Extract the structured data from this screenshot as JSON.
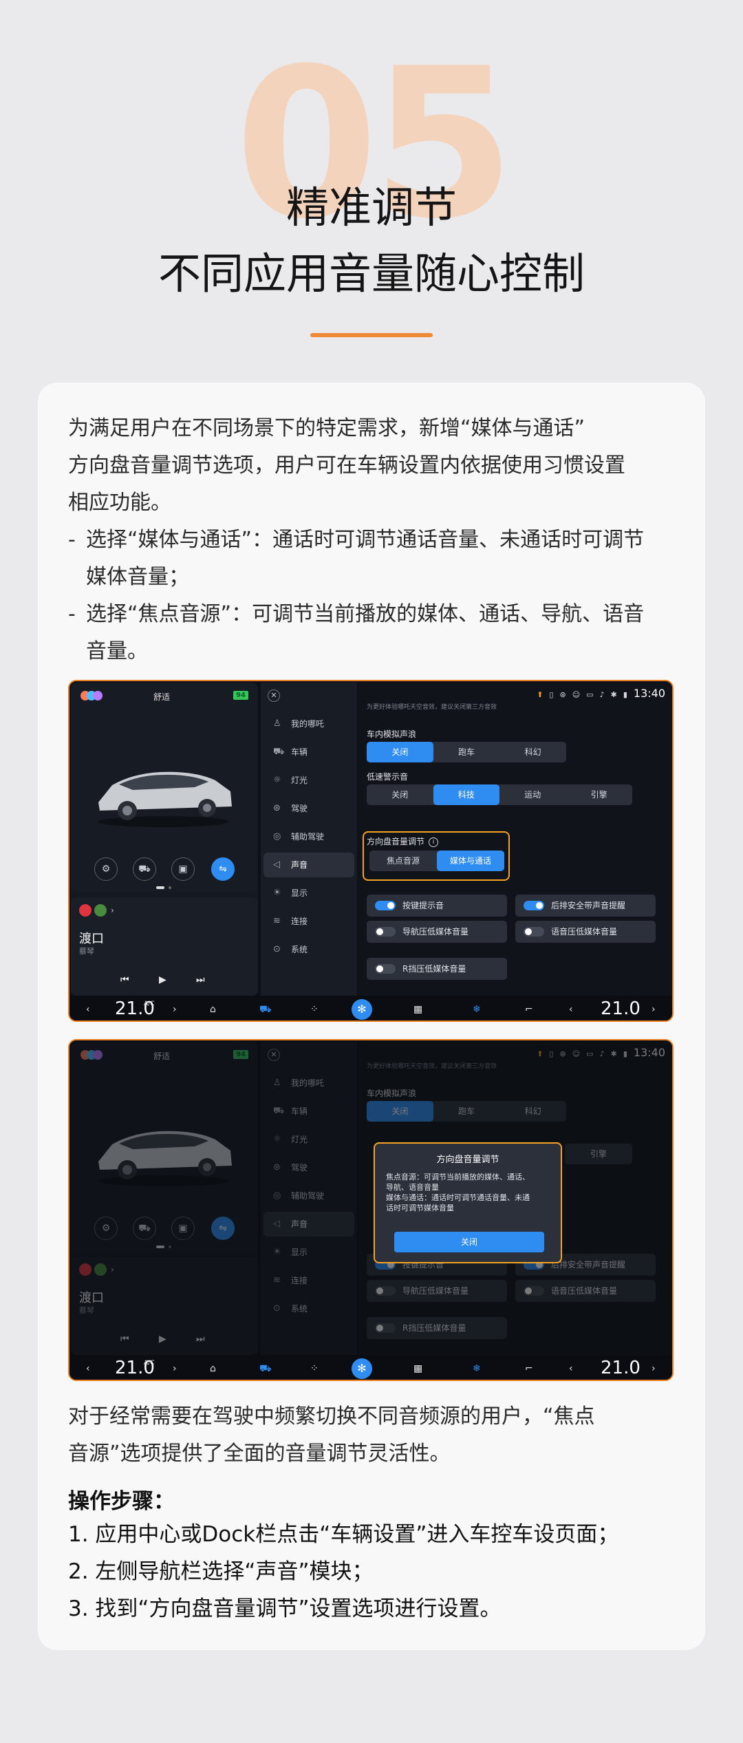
{
  "header": {
    "number": "05",
    "title_line1": "精准调节",
    "title_line2": "不同应用音量随心控制",
    "accent_color": "#f08a34"
  },
  "intro": {
    "line1": "为满足用户在不同场景下的特定需求，新增“媒体与通话”",
    "line2": "方向盘音量调节选项，用户可在车辆设置内依据使用习惯设置",
    "line3": "相应功能。",
    "bullet1_a": "选择“媒体与通话”：通话时可调节通话音量、未通话时可调节",
    "bullet1_b": "媒体音量；",
    "bullet2_a": "选择“焦点音源”：可调节当前播放的媒体、通话、导航、语音",
    "bullet2_b": "音量。"
  },
  "screen": {
    "mode": "舒适",
    "battery": "94",
    "track": "渡口",
    "artist": "蔡琴",
    "time": "13:40",
    "hint": "为更好体验哪吒天空音效，建议关闭第三方音效",
    "nav": [
      "我的哪吒",
      "车辆",
      "灯光",
      "驾驶",
      "辅助驾驶",
      "声音",
      "显示",
      "连接",
      "系统"
    ],
    "sim_wave_label": "车内模拟声浪",
    "sim_wave_options": [
      "关闭",
      "跑车",
      "科幻"
    ],
    "sim_wave_selected": "关闭",
    "low_speed_label": "低速警示音",
    "low_speed_options": [
      "关闭",
      "科技",
      "运动",
      "引擎"
    ],
    "low_speed_selected": "科技",
    "wheel_label": "方向盘音量调节",
    "wheel_options": [
      "焦点音源",
      "媒体与通话"
    ],
    "wheel_selected": "媒体与通话",
    "toggles": [
      {
        "label": "按键提示音",
        "on": true
      },
      {
        "label": "后排安全带声音提醒",
        "on": true
      },
      {
        "label": "导航压低媒体音量",
        "on": false
      },
      {
        "label": "语音压低媒体音量",
        "on": false
      },
      {
        "label": "R挡压低媒体音量",
        "on": false
      }
    ],
    "temp_left": "21.0",
    "temp_right": "21.0",
    "ac_label": "A/C"
  },
  "popup": {
    "title": "方向盘音量调节",
    "line1": "焦点音源：可调节当前播放的媒体、通话、",
    "line2": "导航、语音音量",
    "line3": "媒体与通话：通话时可调节通话音量、未通",
    "line4": "话时可调节媒体音量",
    "button": "关闭"
  },
  "outro": {
    "line1": "对于经常需要在驾驶中频繁切换不同音频源的用户，“焦点",
    "line2": "音源”选项提供了全面的音量调节灵活性。"
  },
  "steps": {
    "heading": "操作步骤：",
    "items": [
      "1. 应用中心或Dock栏点击“车辆设置”进入车控车设页面；",
      "2. 左侧导航栏选择“声音”模块；",
      "3. 找到“方向盘音量调节”设置选项进行设置。"
    ]
  }
}
